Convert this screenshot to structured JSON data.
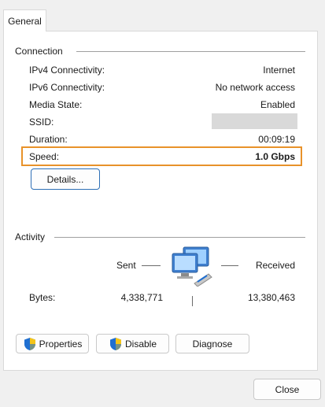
{
  "tabs": [
    {
      "label": "General"
    }
  ],
  "connection": {
    "group_label": "Connection",
    "rows": [
      {
        "label": "IPv4 Connectivity:",
        "value": "Internet"
      },
      {
        "label": "IPv6 Connectivity:",
        "value": "No network access"
      },
      {
        "label": "Media State:",
        "value": "Enabled"
      },
      {
        "label": "SSID:",
        "value": ""
      },
      {
        "label": "Duration:",
        "value": "00:09:19"
      },
      {
        "label": "Speed:",
        "value": "1.0 Gbps"
      }
    ],
    "details_button": "Details...",
    "highlight_color": "#e8922a"
  },
  "activity": {
    "group_label": "Activity",
    "sent_label": "Sent",
    "received_label": "Received",
    "bytes_label": "Bytes:",
    "bytes_sent": "4,338,771",
    "bytes_received": "13,380,463",
    "icon": "network-computers-icon"
  },
  "buttons": {
    "properties": "Properties",
    "disable": "Disable",
    "diagnose": "Diagnose",
    "close": "Close"
  },
  "colors": {
    "accent": "#2d6fb6",
    "highlight": "#e8922a",
    "shield_blue": "#1f6fd1",
    "shield_yellow": "#f5c518"
  }
}
